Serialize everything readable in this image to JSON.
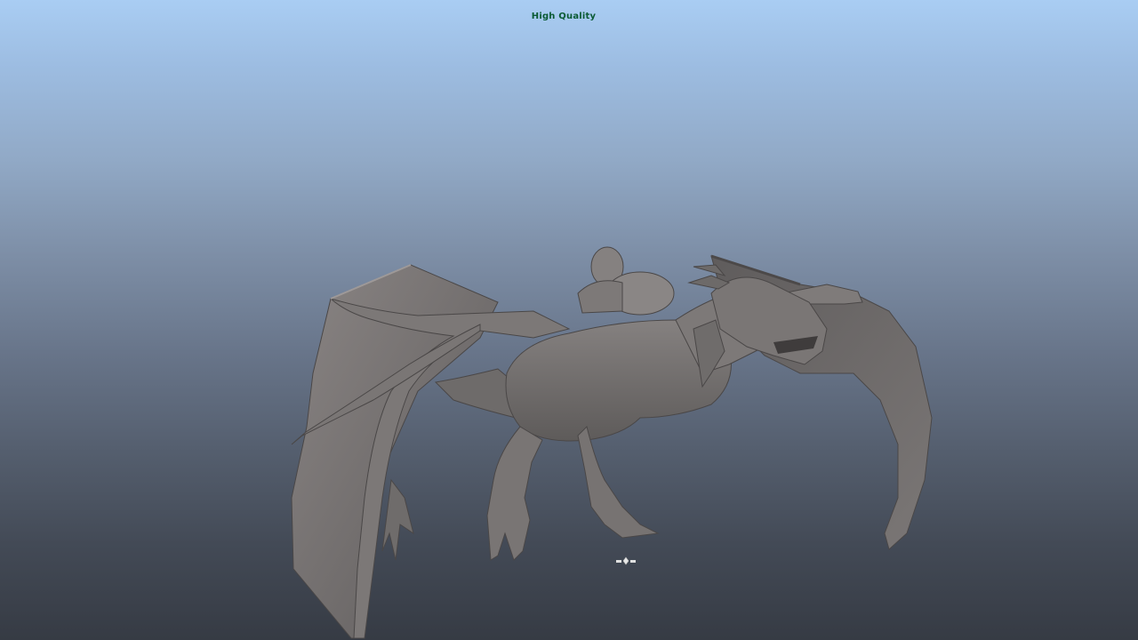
{
  "viewport": {
    "render_mode_label": "High Quality",
    "background_top": "#a9cdf3",
    "background_bottom": "#363b44",
    "label_color": "#0a5a34"
  },
  "scene": {
    "model": "dragon",
    "shading": "smooth-grey",
    "model_color": "#6f6c6b"
  },
  "icons": {
    "pivot": "transform-pivot-icon"
  }
}
